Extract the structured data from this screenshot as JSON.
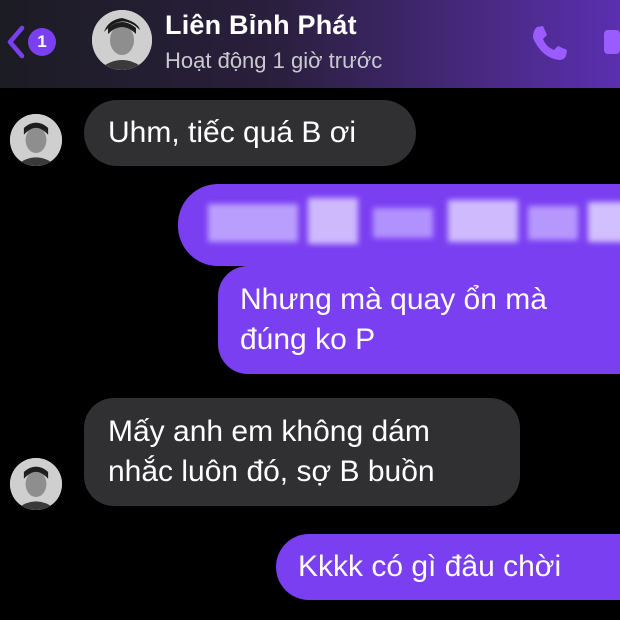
{
  "colors": {
    "accent": "#7b3ff2",
    "incoming_bubble": "#303033",
    "background": "#000000"
  },
  "header": {
    "back_count": "1",
    "contact_name": "Liên Bỉnh Phát",
    "status": "Hoạt động 1 giờ trước",
    "icons": [
      "back-chevron-icon",
      "phone-icon",
      "video-call-icon"
    ]
  },
  "messages": [
    {
      "direction": "incoming",
      "text": "Uhm, tiếc quá B ơi"
    },
    {
      "direction": "outgoing",
      "text": "",
      "blurred": true
    },
    {
      "direction": "outgoing",
      "lines": [
        "Nhưng mà quay ổn mà",
        "đúng ko P"
      ]
    },
    {
      "direction": "incoming",
      "lines": [
        "Mấy anh em không dám",
        "nhắc luôn đó, sợ B buồn"
      ]
    },
    {
      "direction": "outgoing",
      "text": "Kkkk có gì đâu chời"
    }
  ]
}
